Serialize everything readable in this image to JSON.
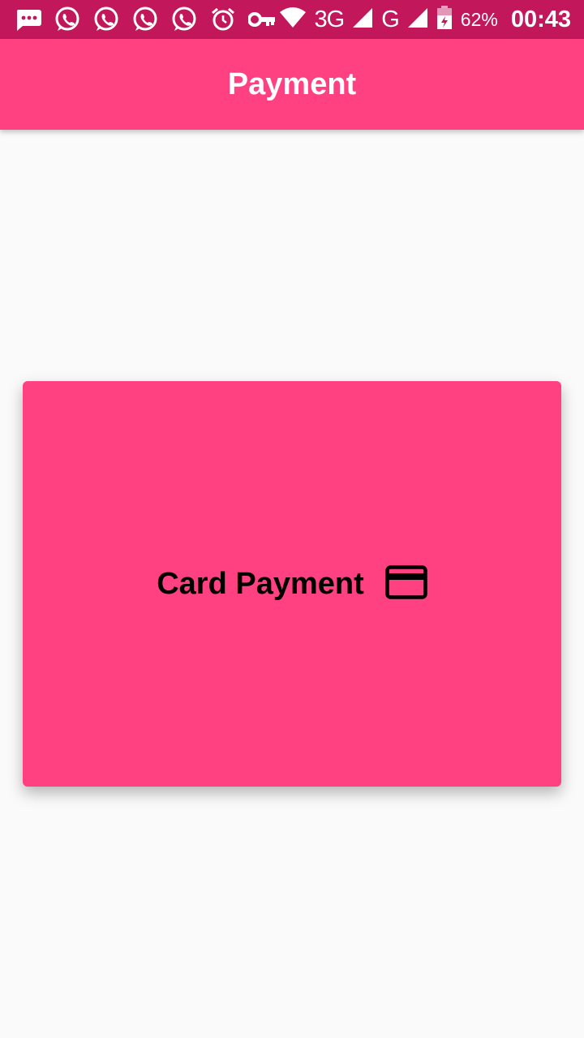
{
  "status_bar": {
    "notification_icons": [
      "message-icon",
      "whatsapp-icon",
      "whatsapp-icon",
      "whatsapp-icon",
      "whatsapp-icon",
      "alarm-icon",
      "key-icon"
    ],
    "network_type": "3G",
    "network_type_2": "G",
    "battery_percent": "62%",
    "time": "00:43",
    "background_color": "#c2185b"
  },
  "app_bar": {
    "title": "Payment",
    "background_color": "#ff4081"
  },
  "card": {
    "label": "Card Payment",
    "icon": "credit-card-icon",
    "background_color": "#ff4081"
  }
}
